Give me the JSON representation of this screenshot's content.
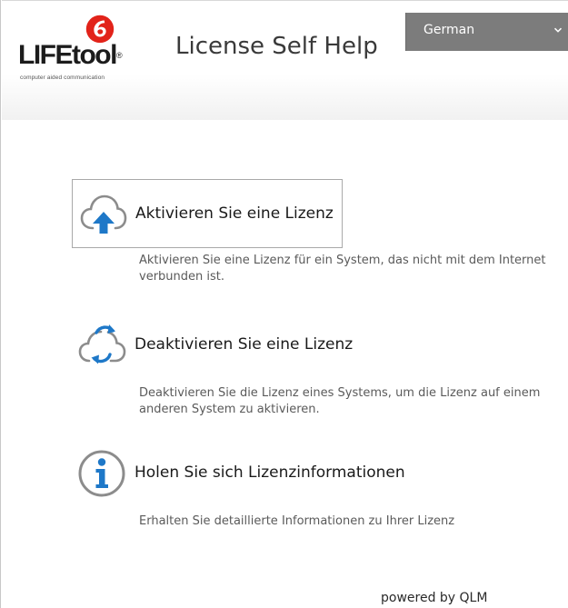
{
  "header": {
    "logo_text": "LIFEtool",
    "logo_reg": "®",
    "logo_tagline": "computer aided communication",
    "title": "License Self Help",
    "language": {
      "selected": "German"
    }
  },
  "colors": {
    "logo_red": "#e2231a",
    "icon_blue": "#1e78c8",
    "icon_gray": "#8c8c8c",
    "language_bg": "#7c7c7c"
  },
  "options": [
    {
      "icon": "cloud-upload-icon",
      "label": "Aktivieren Sie eine Lizenz",
      "description": "Aktivieren Sie eine Lizenz für ein System, das nicht mit dem Internet verbunden ist."
    },
    {
      "icon": "cloud-sync-icon",
      "label": "Deaktivieren Sie eine Lizenz",
      "description": "Deaktivieren Sie die Lizenz eines Systems, um die Lizenz auf einem anderen System zu aktivieren."
    },
    {
      "icon": "info-icon",
      "label": "Holen Sie sich Lizenzinformationen",
      "description": "Erhalten Sie detaillierte Informationen zu Ihrer Lizenz"
    }
  ],
  "footer": {
    "powered_by": "powered by QLM"
  }
}
